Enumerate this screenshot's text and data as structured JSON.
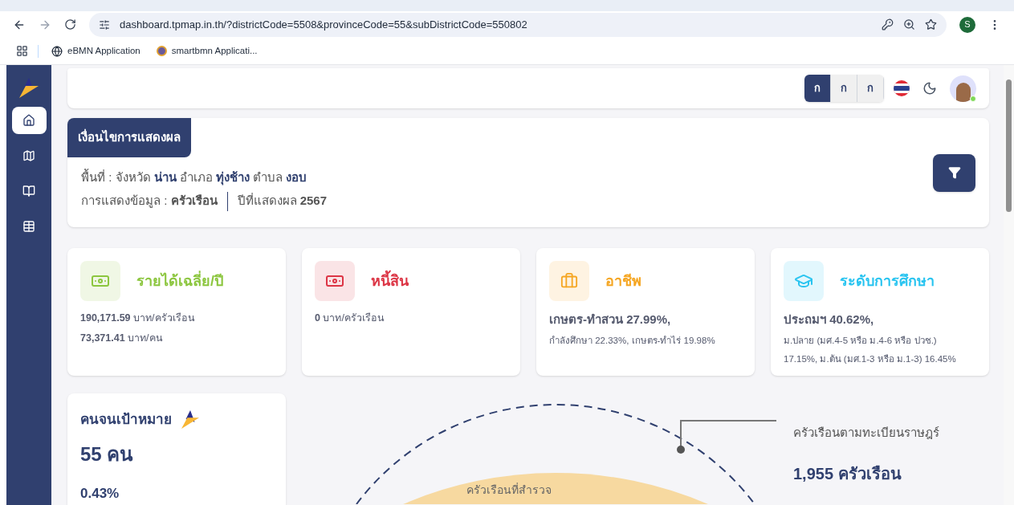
{
  "browser": {
    "url": "dashboard.tpmap.in.th/?districtCode=5508&provinceCode=55&subDistrictCode=550802",
    "profile_initial": "S",
    "bookmarks": [
      {
        "label": "eBMN Application",
        "kind": "globe"
      },
      {
        "label": "smartbmn Applicati...",
        "kind": "emblem"
      }
    ]
  },
  "sidebar": {
    "items": [
      {
        "kind": "home",
        "selected": true
      },
      {
        "kind": "map",
        "selected": false
      },
      {
        "kind": "compare",
        "selected": false
      },
      {
        "kind": "table",
        "selected": false
      }
    ]
  },
  "header": {
    "font_sizes": [
      {
        "label": "ก",
        "selected": true
      },
      {
        "label": "ก",
        "selected": false
      },
      {
        "label": "ก",
        "selected": false
      }
    ],
    "user_online": true
  },
  "filter": {
    "title": "เงื่อนไขการแสดงผล",
    "area_line": "พื้นที่ : จังหวัด **น่าน** อำเภอ **ทุ่งช้าง** ตำบล **งอบ**",
    "data_line": "การแสดงข้อมูล : **ครัวเรือน**",
    "year_line": "ปีที่แสดงผล **2567**"
  },
  "stats": [
    {
      "kind": "income",
      "title": "รายได้เฉลี่ย/ปี",
      "color": "#8cc63f",
      "lines": [
        "**190,171.59** บาท/ครัวเรือน",
        "**73,371.41** บาท/คน"
      ]
    },
    {
      "kind": "debt",
      "title": "หนี้สิน",
      "color": "#dc3545",
      "lines": [
        "**0** บาท/ครัวเรือน"
      ]
    },
    {
      "kind": "job",
      "title": "อาชีพ",
      "color": "#f5a623",
      "lead": "เกษตร-ทำสวน 27.99%,",
      "lines": [
        "กำลังศึกษา 22.33%, เกษตร-ทำไร่ 19.98%"
      ]
    },
    {
      "kind": "education",
      "title": "ระดับการศึกษา",
      "color": "#29c4f0",
      "lead": "ประถมฯ 40.62%,",
      "lines": [
        "ม.ปลาย (มศ.4-5 หรือ ม.4-6 หรือ ปวช.)",
        "17.15%, ม.ต้น (มศ.1-3 หรือ ม.1-3) 16.45%"
      ]
    }
  ],
  "target": {
    "title": "คนจนเป้าหมาย",
    "count": "55 คน",
    "percent": "0.43%"
  },
  "chart": {
    "outer_label": "ครัวเรือนตามทะเบียนราษฎร์",
    "outer_value": "1,955 ครัวเรือน",
    "inner_label": "ครัวเรือนที่สำรวจ"
  }
}
